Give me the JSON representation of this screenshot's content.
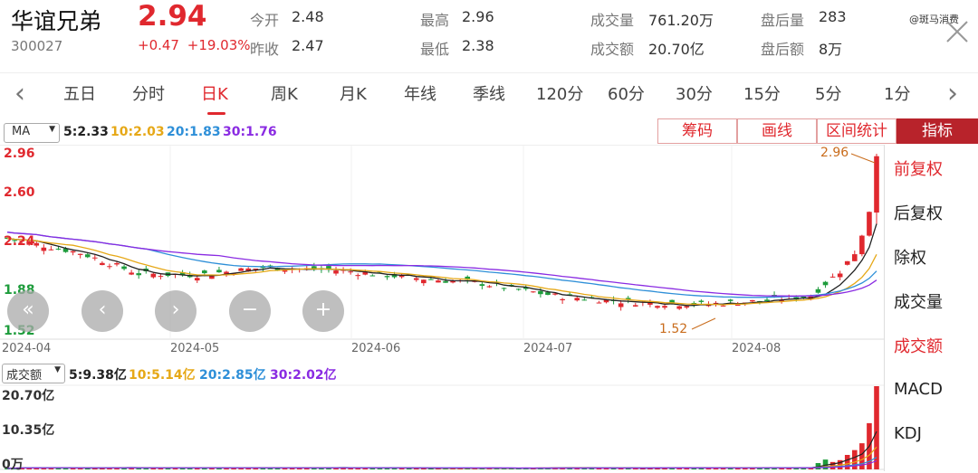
{
  "header": {
    "name": "华谊兄弟",
    "code": "300027",
    "price": "2.94",
    "change_abs": "+0.47",
    "change_pct": "+19.03%",
    "quotes": [
      {
        "label": "今开",
        "value": "2.48"
      },
      {
        "label": "昨收",
        "value": "2.47"
      },
      {
        "label": "最高",
        "value": "2.96"
      },
      {
        "label": "最低",
        "value": "2.38"
      },
      {
        "label": "成交量",
        "value": "761.20万"
      },
      {
        "label": "成交额",
        "value": "20.70亿"
      },
      {
        "label": "盘后量",
        "value": "283"
      },
      {
        "label": "盘后额",
        "value": "8万"
      }
    ],
    "watermark": "@斑马消费"
  },
  "tabs": [
    "五日",
    "分时",
    "日K",
    "周K",
    "月K",
    "年线",
    "季线",
    "120分",
    "60分",
    "30分",
    "15分",
    "5分",
    "1分"
  ],
  "active_tab": "日K",
  "toolbar": {
    "ma_select": "MA",
    "ma5": "5:2.33",
    "ma10": "10:2.03",
    "ma20": "20:1.83",
    "ma30": "30:1.76",
    "buttons": [
      "筹码",
      "画线",
      "区间统计",
      "指标"
    ]
  },
  "right_panel": {
    "items": [
      "前复权",
      "后复权",
      "除权",
      "成交量",
      "成交额",
      "MACD",
      "KDJ"
    ],
    "active": [
      "前复权",
      "成交额"
    ]
  },
  "chart": {
    "y_labels": [
      "2.96",
      "2.60",
      "2.24",
      "1.88",
      "1.52"
    ],
    "x_labels": [
      "2024-04",
      "2024-05",
      "2024-06",
      "2024-07",
      "2024-08"
    ],
    "high_annotation": "2.96",
    "low_annotation": "1.52"
  },
  "volume": {
    "select": "成交额",
    "ma5": "5:9.38亿",
    "ma10": "10:5.14亿",
    "ma20": "20:2.85亿",
    "ma30": "30:2.02亿",
    "y_labels": [
      "20.70亿",
      "10.35亿",
      "0万"
    ]
  },
  "colors": {
    "up": "#e0282e",
    "down": "#1e9c3c",
    "ma5": "#222222",
    "ma10": "#e6a817",
    "ma20": "#2e8fd8",
    "ma30": "#8a2be2"
  },
  "chart_data": {
    "type": "candlestick",
    "ylim": [
      1.52,
      2.96
    ],
    "high": 2.96,
    "low": 1.52,
    "last_close": 2.94,
    "ma": {
      "ma5": 2.33,
      "ma10": 2.03,
      "ma20": 1.83,
      "ma30": 1.76
    },
    "volume_ylim": [
      0,
      20.7
    ],
    "volume_unit": "亿"
  }
}
